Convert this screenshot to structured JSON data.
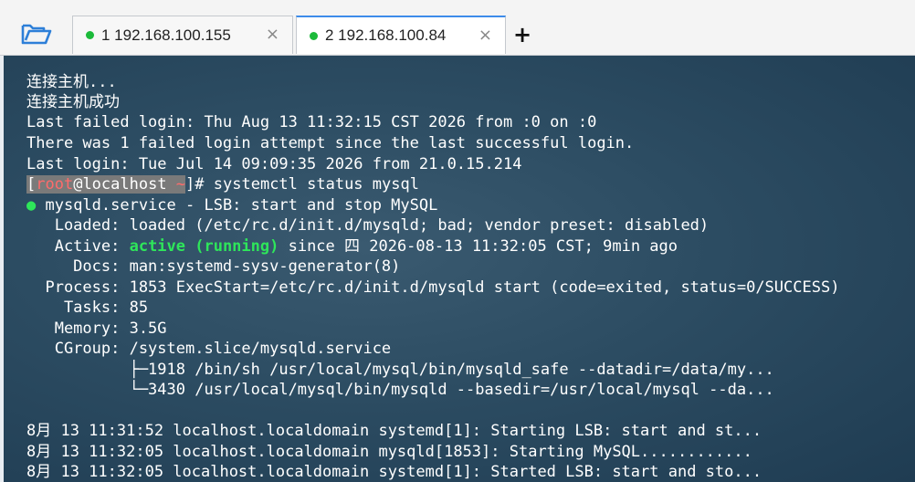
{
  "toolbar": {
    "folder_icon": "folder-open-icon"
  },
  "tabs": [
    {
      "label": "1 192.168.100.155",
      "status_color": "#1cba3a",
      "close": "×",
      "active": false
    },
    {
      "label": "2 192.168.100.84",
      "status_color": "#1cba3a",
      "close": "×",
      "active": true
    }
  ],
  "add_tab": "+",
  "terminal": {
    "lines": [
      "连接主机...",
      "连接主机成功",
      "Last failed login: Thu Aug 13 11:32:15 CST 2026 from :0 on :0",
      "There was 1 failed login attempt since the last successful login.",
      "Last login: Tue Jul 14 09:09:35 2026 from 21.0.15.214"
    ],
    "prompt": {
      "open": "[",
      "user": "root",
      "at": "@localhost ",
      "path": "~",
      "close": "]",
      "sign": "# ",
      "command": "systemctl status mysql"
    },
    "status": {
      "bullet": "●",
      "service": " mysqld.service - LSB: start and stop MySQL",
      "loaded": "   Loaded: loaded (/etc/rc.d/init.d/mysqld; bad; vendor preset: disabled)",
      "active_prefix": "   Active: ",
      "active_state": "active (running)",
      "active_suffix": " since 四 2026-08-13 11:32:05 CST; 9min ago",
      "docs": "     Docs: man:systemd-sysv-generator(8)",
      "process": "  Process: 1853 ExecStart=/etc/rc.d/init.d/mysqld start (code=exited, status=0/SUCCESS)",
      "tasks": "    Tasks: 85",
      "memory": "   Memory: 3.5G",
      "cgroup": "   CGroup: /system.slice/mysqld.service",
      "tree1": "           ├─1918 /bin/sh /usr/local/mysql/bin/mysqld_safe --datadir=/data/my...",
      "tree2": "           └─3430 /usr/local/mysql/bin/mysqld --basedir=/usr/local/mysql --da..."
    },
    "logs": [
      "8月 13 11:31:52 localhost.localdomain systemd[1]: Starting LSB: start and st...",
      "8月 13 11:32:05 localhost.localdomain mysqld[1853]: Starting MySQL............",
      "8月 13 11:32:05 localhost.localdomain systemd[1]: Started LSB: start and sto..."
    ]
  }
}
